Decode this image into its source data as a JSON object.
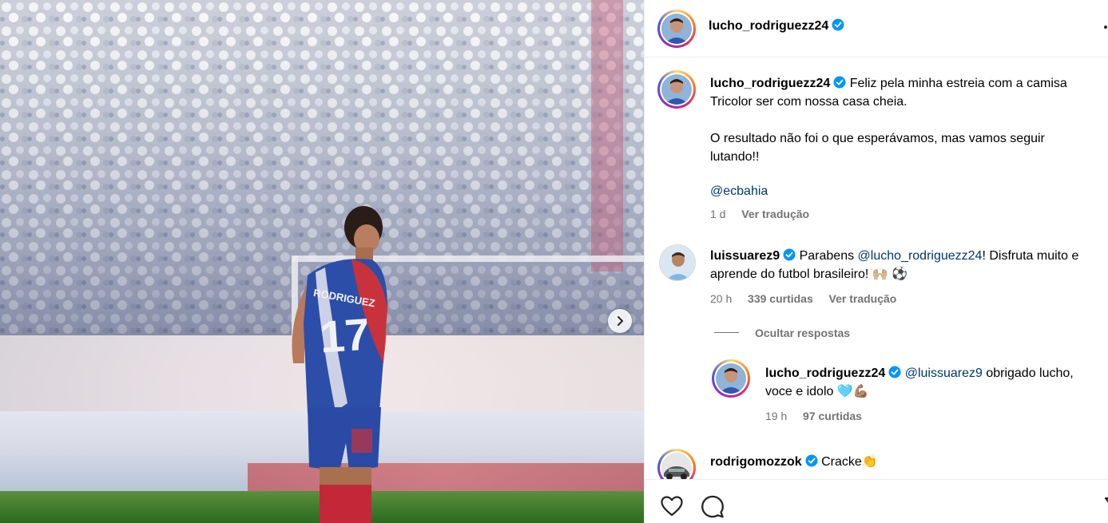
{
  "post": {
    "author": "lucho_rodriguezz24",
    "caption_line1": "Feliz pela minha estreia com a camisa",
    "caption_line2": "Tricolor ser com nossa casa cheia.",
    "caption_line3": "O resultado não foi o que esperávamos, mas vamos seguir",
    "caption_line4": "lutando!!",
    "caption_mention": "@ecbahia",
    "time": "1 d",
    "translate_label": "Ver tradução"
  },
  "comments": [
    {
      "author": "luissuarez9",
      "text_before": "Parabens ",
      "mention": "@lucho_rodriguezz24",
      "text_after": "! Disfruta muito e",
      "text_line2": "aprende do futbol brasileiro! 🙌🏼 ⚽",
      "time": "20 h",
      "likes": "339 curtidas",
      "translate_label": "Ver tradução",
      "hide_replies_label": "Ocultar respostas"
    },
    {
      "author": "lucho_rodriguezz24",
      "mention": "@luissuarez9",
      "text_after": " obrigado lucho,",
      "text_line2": "voce e idolo 🩵💪🏽",
      "time": "19 h",
      "likes": "97 curtidas"
    },
    {
      "author": "rodrigomozzok",
      "text": "Cracke👏"
    }
  ],
  "colors": {
    "verified_blue": "#0095f6",
    "mention_blue": "#00376b",
    "meta_grey": "#737373"
  },
  "icons": [
    "verified-badge-icon",
    "more-options-icon",
    "chevron-right-icon",
    "heart-icon",
    "comment-icon"
  ]
}
